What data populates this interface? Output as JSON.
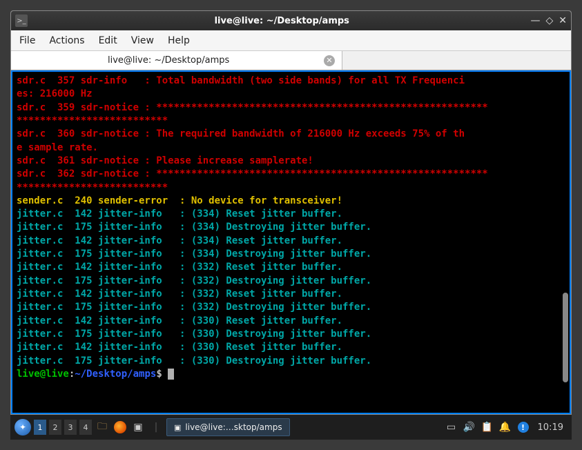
{
  "window": {
    "title": "live@live: ~/Desktop/amps",
    "icon_label": ">_"
  },
  "menubar": [
    "File",
    "Actions",
    "Edit",
    "View",
    "Help"
  ],
  "tab": {
    "label": "live@live: ~/Desktop/amps"
  },
  "terminal": {
    "lines": [
      {
        "cls": "red",
        "text": "sdr.c  357 sdr-info   : Total bandwidth (two side bands) for all TX Frequenci"
      },
      {
        "cls": "red",
        "text": "es: 216000 Hz"
      },
      {
        "cls": "red",
        "text": "sdr.c  359 sdr-notice : *********************************************************"
      },
      {
        "cls": "red",
        "text": "**************************"
      },
      {
        "cls": "red",
        "text": "sdr.c  360 sdr-notice : The required bandwidth of 216000 Hz exceeds 75% of th"
      },
      {
        "cls": "red",
        "text": "e sample rate."
      },
      {
        "cls": "red",
        "text": "sdr.c  361 sdr-notice : Please increase samplerate!"
      },
      {
        "cls": "red",
        "text": "sdr.c  362 sdr-notice : *********************************************************"
      },
      {
        "cls": "red",
        "text": "**************************"
      },
      {
        "cls": "yellow",
        "text": "sender.c  240 sender-error  : No device for transceiver!"
      },
      {
        "cls": "cyan",
        "text": "jitter.c  142 jitter-info   : (334) Reset jitter buffer."
      },
      {
        "cls": "cyan",
        "text": "jitter.c  175 jitter-info   : (334) Destroying jitter buffer."
      },
      {
        "cls": "cyan",
        "text": "jitter.c  142 jitter-info   : (334) Reset jitter buffer."
      },
      {
        "cls": "cyan",
        "text": "jitter.c  175 jitter-info   : (334) Destroying jitter buffer."
      },
      {
        "cls": "cyan",
        "text": "jitter.c  142 jitter-info   : (332) Reset jitter buffer."
      },
      {
        "cls": "cyan",
        "text": "jitter.c  175 jitter-info   : (332) Destroying jitter buffer."
      },
      {
        "cls": "cyan",
        "text": "jitter.c  142 jitter-info   : (332) Reset jitter buffer."
      },
      {
        "cls": "cyan",
        "text": "jitter.c  175 jitter-info   : (332) Destroying jitter buffer."
      },
      {
        "cls": "cyan",
        "text": "jitter.c  142 jitter-info   : (330) Reset jitter buffer."
      },
      {
        "cls": "cyan",
        "text": "jitter.c  175 jitter-info   : (330) Destroying jitter buffer."
      },
      {
        "cls": "cyan",
        "text": "jitter.c  142 jitter-info   : (330) Reset jitter buffer."
      },
      {
        "cls": "cyan",
        "text": "jitter.c  175 jitter-info   : (330) Destroying jitter buffer."
      }
    ],
    "prompt": {
      "user": "live@live",
      "colon": ":",
      "path": "~/Desktop/amps",
      "suffix": "$ "
    }
  },
  "taskbar": {
    "workspaces": [
      "1",
      "2",
      "3",
      "4"
    ],
    "active_ws": 0,
    "window_button": "live@live:…sktop/amps",
    "clock": "10:19"
  }
}
